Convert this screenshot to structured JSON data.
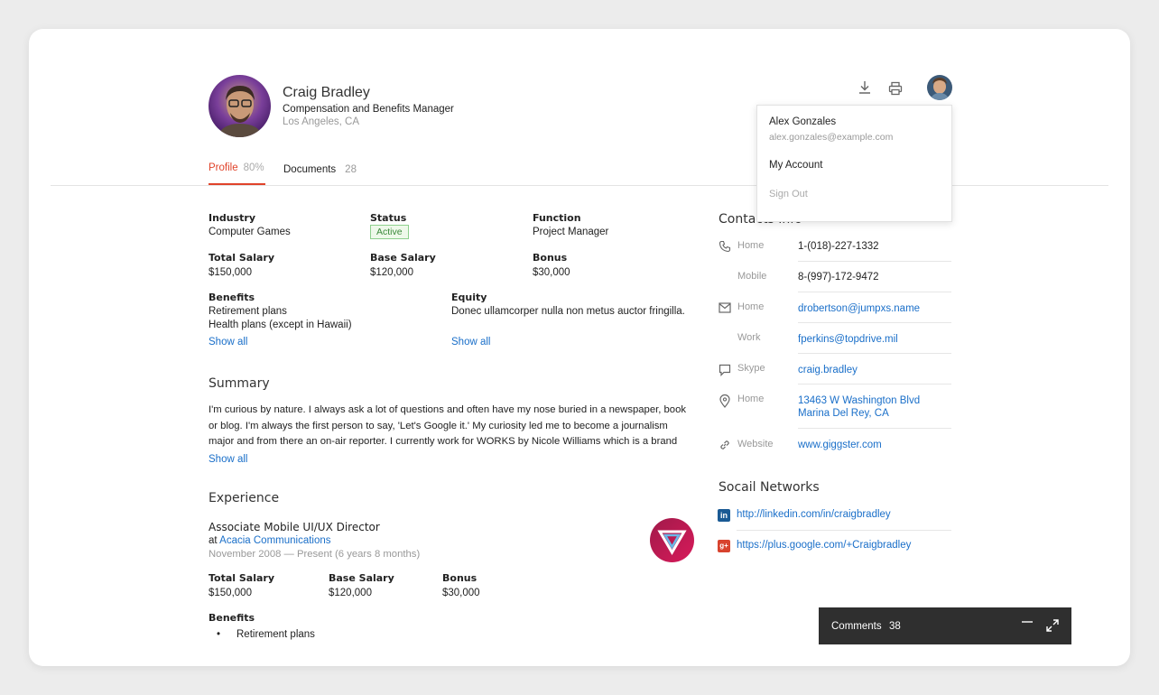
{
  "profile": {
    "name": "Craig Bradley",
    "title": "Compensation and Benefits Manager",
    "location": "Los Angeles, CA"
  },
  "tabs": [
    {
      "label": "Profile",
      "count": "80%"
    },
    {
      "label": "Documents",
      "count": "28"
    }
  ],
  "details": {
    "industry_label": "Industry",
    "industry_value": "Computer Games",
    "status_label": "Status",
    "status_value": "Active",
    "function_label": "Function",
    "function_value": "Project Manager",
    "total_salary_label": "Total Salary",
    "total_salary_value": "$150,000",
    "base_salary_label": "Base Salary",
    "base_salary_value": "$120,000",
    "bonus_label": "Bonus",
    "bonus_value": "$30,000",
    "benefits_label": "Benefits",
    "benefits_items": [
      "Retirement plans",
      "Health plans (except in Hawaii)"
    ],
    "equity_label": "Equity",
    "equity_value": "Donec ullamcorper nulla non metus auctor fringilla.",
    "show_all": "Show all"
  },
  "summary": {
    "heading": "Summary",
    "text": "I'm curious by nature. I always ask a lot of questions and often have my nose buried in a newspaper, book or blog. I'm always the first person to say, 'Let's Google it.' My curiosity led me to become a journalism major and from there an on-air reporter. I currently work for WORKS by Nicole Williams which is a brand that helps",
    "show_all": "Show all"
  },
  "experience": {
    "heading": "Experience",
    "role": "Associate Mobile UI/UX Director",
    "at": "at",
    "company": "Acacia Communications",
    "dates": "November 2008 — Present (6 years 8 months)",
    "total_salary_label": "Total Salary",
    "total_salary_value": "$150,000",
    "base_salary_label": "Base Salary",
    "base_salary_value": "$120,000",
    "bonus_label": "Bonus",
    "bonus_value": "$30,000",
    "benefits_label": "Benefits",
    "benefits_items": [
      "Retirement plans"
    ]
  },
  "account_menu": {
    "user_name": "Alex Gonzales",
    "user_email": "alex.gonzales@example.com",
    "my_account": "My Account",
    "sign_out": "Sign Out"
  },
  "contacts": {
    "heading": "Contacts Info",
    "rows": [
      {
        "label": "Home",
        "value": "1-(018)-227-1332",
        "icon": "phone-icon"
      },
      {
        "label": "Mobile",
        "value": "8-(997)-172-9472"
      },
      {
        "label": "Home",
        "value": "drobertson@jumpxs.name",
        "icon": "mail-icon"
      },
      {
        "label": "Work",
        "value": "fperkins@topdrive.mil"
      },
      {
        "label": "Skype",
        "value": "craig.bradley",
        "icon": "chat-icon"
      },
      {
        "label": "Home",
        "value": "13463 W Washington Blvd",
        "value2": "Marina Del Rey, CA",
        "icon": "location-pin-icon"
      },
      {
        "label": "Website",
        "value": "www.giggster.com",
        "icon": "link-icon"
      }
    ]
  },
  "social": {
    "heading": "Socail Networks",
    "linkedin": "http://linkedin.com/in/craigbradley",
    "googleplus": "https://plus.google.com/+Craigbradley"
  },
  "comments": {
    "label": "Comments",
    "count": "38"
  },
  "colors": {
    "accent": "#e0432a",
    "link": "#1a6fc9",
    "status_green": "#3b8a3b"
  }
}
